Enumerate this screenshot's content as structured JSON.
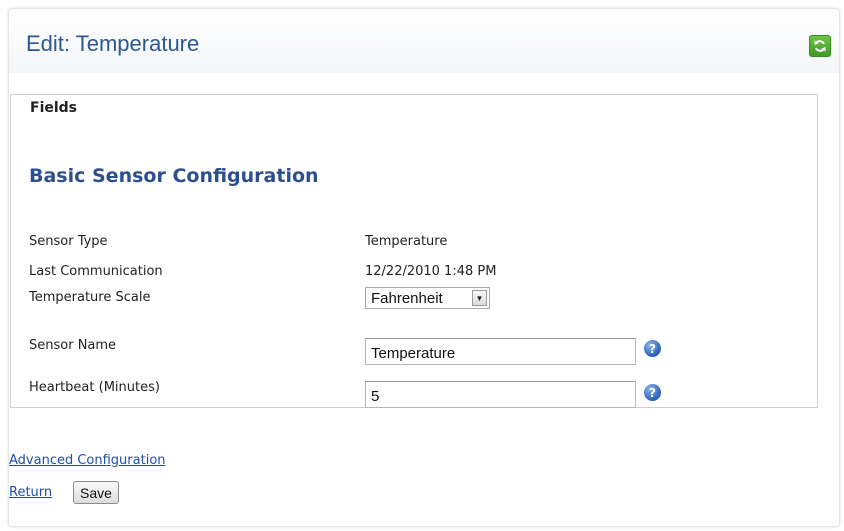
{
  "header": {
    "title": "Edit: Temperature",
    "refresh_icon": "refresh-icon"
  },
  "fields": {
    "legend": "Fields",
    "section_title": "Basic Sensor Configuration",
    "sensor_type": {
      "label": "Sensor Type",
      "value": "Temperature"
    },
    "last_communication": {
      "label": "Last Communication",
      "value": "12/22/2010 1:48 PM"
    },
    "temperature_scale": {
      "label": "Temperature Scale",
      "selected": "Fahrenheit"
    },
    "sensor_name": {
      "label": "Sensor Name",
      "value": "Temperature"
    },
    "heartbeat": {
      "label": "Heartbeat (Minutes)",
      "value": "5"
    },
    "help_icon": "help-icon"
  },
  "links": {
    "advanced": "Advanced Configuration",
    "return": "Return"
  },
  "actions": {
    "save_label": "Save"
  },
  "colors": {
    "title": "#2d5790",
    "section_title": "#2d4f8e",
    "link": "#1f4ea3",
    "refresh_button": "#4caf33"
  }
}
